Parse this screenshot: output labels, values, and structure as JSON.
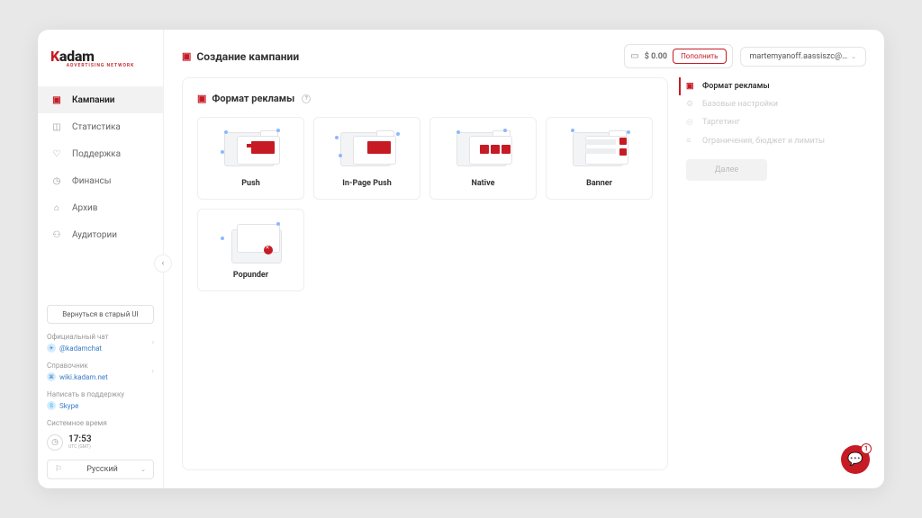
{
  "brand": {
    "name": "Kadam",
    "tagline": "ADVERTISING NETWORK"
  },
  "nav": [
    {
      "label": "Кампании",
      "icon": "folder-icon"
    },
    {
      "label": "Статистика",
      "icon": "chart-icon"
    },
    {
      "label": "Поддержка",
      "icon": "heart-icon"
    },
    {
      "label": "Финансы",
      "icon": "clock-icon"
    },
    {
      "label": "Архив",
      "icon": "archive-icon"
    },
    {
      "label": "Аудитории",
      "icon": "people-icon"
    }
  ],
  "sidebar": {
    "old_ui_button": "Вернуться в старый UI",
    "official_chat": {
      "title": "Официальный чат",
      "link": "@kadamchat"
    },
    "reference": {
      "title": "Справочник",
      "link": "wiki.kadam.net"
    },
    "support": {
      "title": "Написать в поддержку",
      "link": "Skype"
    },
    "system_time": {
      "title": "Системное время",
      "time": "17:53",
      "tz": "UTC (GMT)"
    },
    "language": "Русский"
  },
  "header": {
    "page_title": "Создание кампании",
    "balance": "$ 0.00",
    "topup": "Пополнить",
    "user": "martemyanoff.aassiszc@…"
  },
  "panel": {
    "title": "Формат рекламы",
    "formats": [
      {
        "label": "Push"
      },
      {
        "label": "In-Page Push"
      },
      {
        "label": "Native"
      },
      {
        "label": "Banner"
      },
      {
        "label": "Popunder"
      }
    ]
  },
  "steps": {
    "items": [
      {
        "label": "Формат рекламы",
        "icon": "folder-icon"
      },
      {
        "label": "Базовые настройки",
        "icon": "gear-icon"
      },
      {
        "label": "Таргетинг",
        "icon": "target-icon"
      },
      {
        "label": "Ограничения, бюджет и лимиты",
        "icon": "limits-icon"
      }
    ],
    "next": "Далее"
  },
  "chat": {
    "badge": "1"
  }
}
